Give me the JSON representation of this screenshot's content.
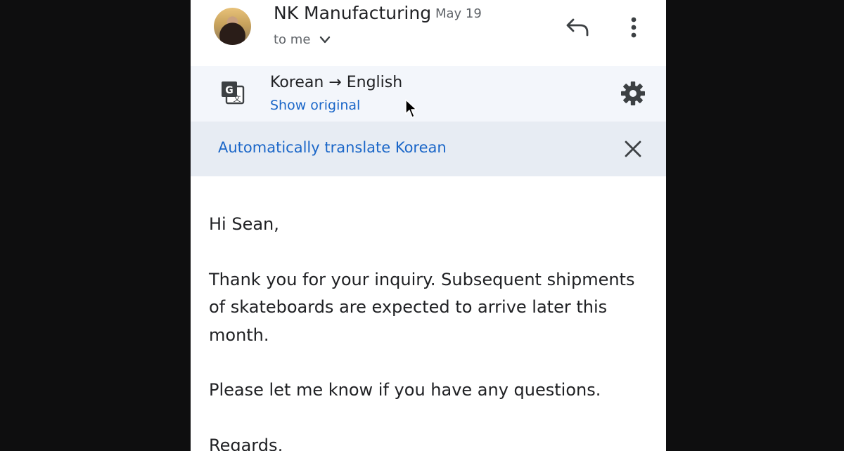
{
  "email": {
    "sender": "NK Manufacturing",
    "date": "May 19",
    "recipient": "to me",
    "icons": {
      "reply": "reply-icon",
      "more": "more-vertical-icon",
      "expand": "chevron-down-icon"
    }
  },
  "translation": {
    "language_pair": "Korean → English",
    "show_original": "Show original",
    "auto_translate": "Automatically translate Korean",
    "icons": {
      "translate": "translate-icon",
      "settings": "gear-icon",
      "close": "close-icon"
    }
  },
  "body": {
    "greeting": "Hi Sean,",
    "paragraph1": "Thank you for your inquiry. Subsequent shipments of skateboards are expected to arrive later this month.",
    "paragraph2": "Please let me know if you have any questions.",
    "closing": "Regards,"
  },
  "colors": {
    "link": "#1a66c8",
    "translate_bar": "#f3f6fb",
    "auto_bar": "#e7ecf3",
    "backdrop": "#0e0e0f"
  }
}
